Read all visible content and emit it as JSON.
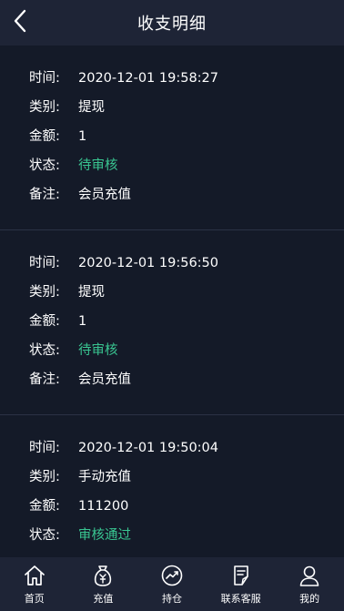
{
  "header": {
    "title": "收支明细",
    "back_icon": "chevron-left-icon"
  },
  "records": [
    {
      "time_label": "时间:",
      "time": "2020-12-01 19:58:27",
      "type_label": "类别:",
      "type": "提现",
      "amount_label": "金额:",
      "amount": "1",
      "status_label": "状态:",
      "status": "待审核",
      "note_label": "备注:",
      "note": "会员充值"
    },
    {
      "time_label": "时间:",
      "time": "2020-12-01 19:56:50",
      "type_label": "类别:",
      "type": "提现",
      "amount_label": "金额:",
      "amount": "1",
      "status_label": "状态:",
      "status": "待审核",
      "note_label": "备注:",
      "note": "会员充值"
    },
    {
      "time_label": "时间:",
      "time": "2020-12-01 19:50:04",
      "type_label": "类别:",
      "type": "手动充值",
      "amount_label": "金额:",
      "amount": "111200",
      "status_label": "状态:",
      "status": "审核通过"
    }
  ],
  "tabbar": {
    "items": [
      {
        "label": "首页",
        "icon": "home-icon"
      },
      {
        "label": "充值",
        "icon": "money-bag-icon"
      },
      {
        "label": "持仓",
        "icon": "trend-chart-icon"
      },
      {
        "label": "联系客服",
        "icon": "document-edit-icon"
      },
      {
        "label": "我的",
        "icon": "user-icon"
      }
    ]
  },
  "colors": {
    "background": "#141a28",
    "bar": "#1e2436",
    "status_green": "#39c591",
    "divider": "#2b3245"
  }
}
